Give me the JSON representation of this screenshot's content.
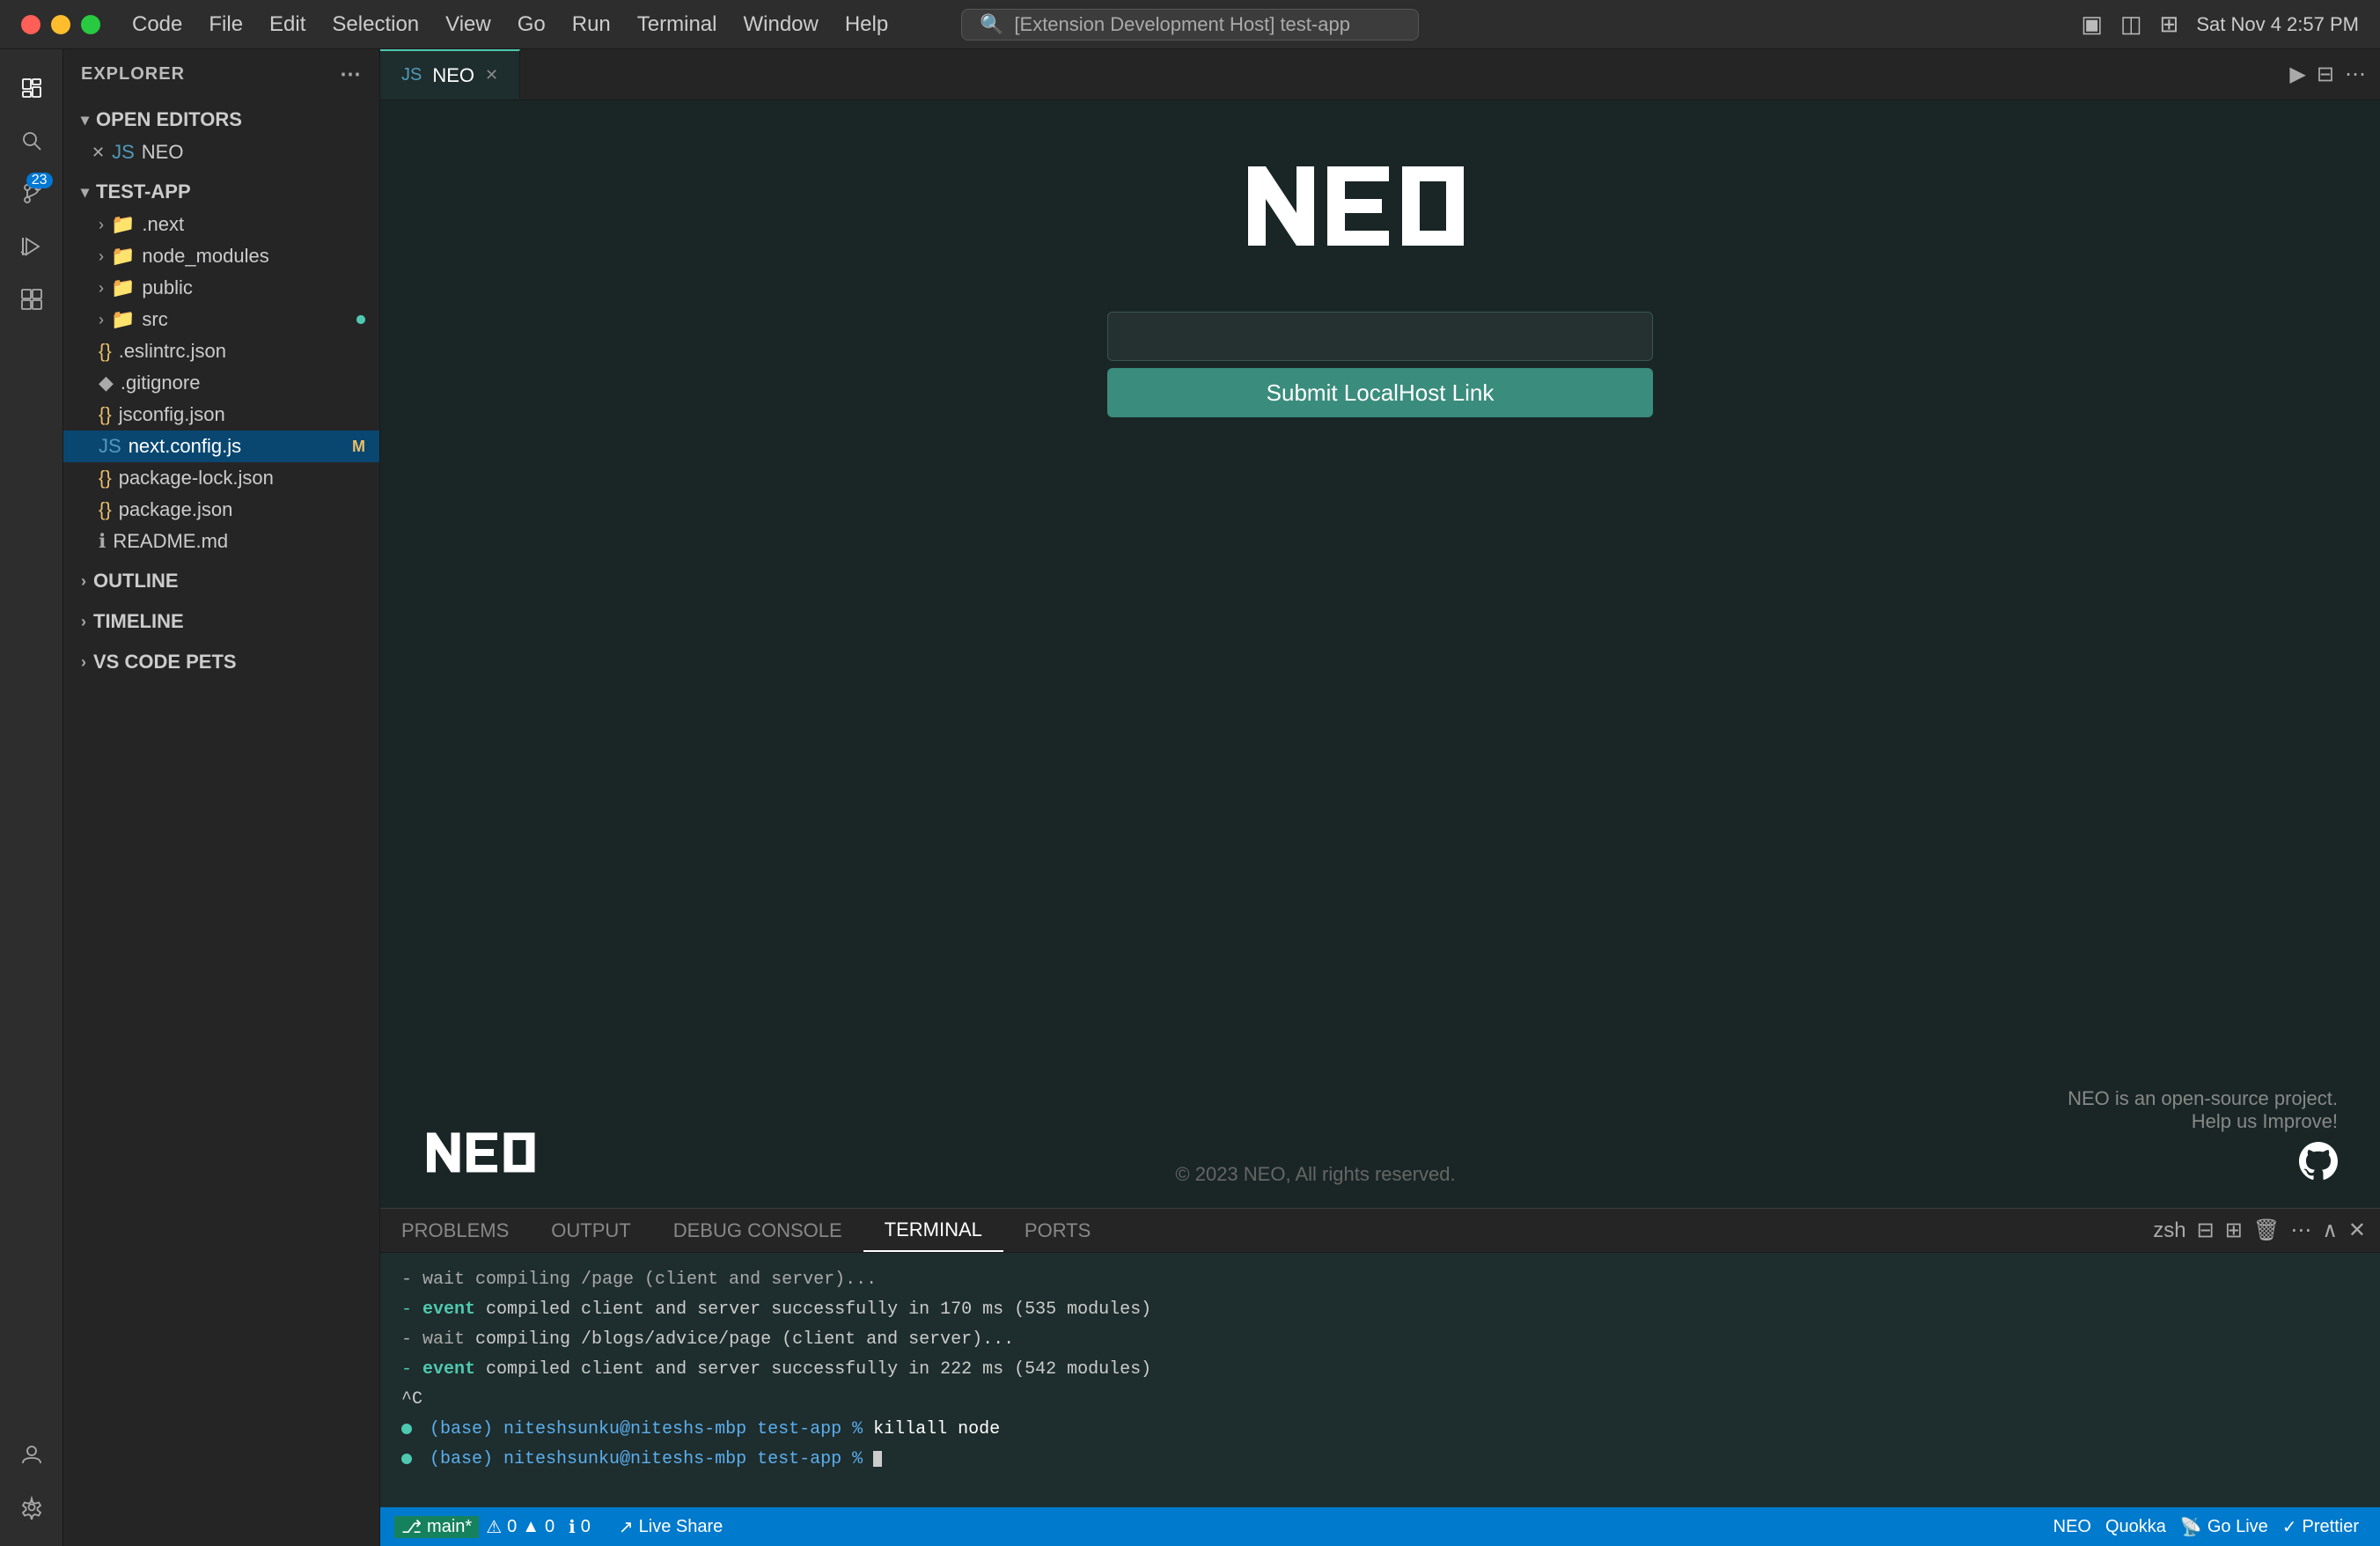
{
  "titlebar": {
    "menus": [
      "Code",
      "File",
      "Edit",
      "Selection",
      "View",
      "Go",
      "Run",
      "Terminal",
      "Window",
      "Help"
    ],
    "search_text": "[Extension Development Host] test-app",
    "time": "Sat Nov 4  2:57 PM"
  },
  "activity_bar": {
    "icons": [
      {
        "name": "files-icon",
        "symbol": "⬜",
        "label": "Explorer"
      },
      {
        "name": "search-icon",
        "symbol": "🔍",
        "label": "Search"
      },
      {
        "name": "source-control-icon",
        "symbol": "⎇",
        "label": "Source Control"
      },
      {
        "name": "run-icon",
        "symbol": "▶",
        "label": "Run"
      },
      {
        "name": "extensions-icon",
        "symbol": "⊞",
        "label": "Extensions"
      }
    ],
    "badge_count": "23"
  },
  "sidebar": {
    "title": "EXPLORER",
    "sections": {
      "open_editors": {
        "label": "OPEN EDITORS",
        "items": [
          {
            "name": "NEO",
            "icon": "js",
            "modified": false
          }
        ]
      },
      "test_app": {
        "label": "TEST-APP",
        "items": [
          {
            "name": ".next",
            "icon": "folder",
            "depth": 1
          },
          {
            "name": "node_modules",
            "icon": "folder",
            "depth": 1
          },
          {
            "name": "public",
            "icon": "folder",
            "depth": 1
          },
          {
            "name": "src",
            "icon": "folder",
            "depth": 1,
            "modified": true
          },
          {
            "name": ".eslintrc.json",
            "icon": "json",
            "depth": 1
          },
          {
            "name": ".gitignore",
            "icon": "git",
            "depth": 1
          },
          {
            "name": "jsconfig.json",
            "icon": "json",
            "depth": 1
          },
          {
            "name": "next.config.js",
            "icon": "js",
            "depth": 1,
            "badge": "M"
          },
          {
            "name": "package-lock.json",
            "icon": "json",
            "depth": 1
          },
          {
            "name": "package.json",
            "icon": "json",
            "depth": 1
          },
          {
            "name": "README.md",
            "icon": "md",
            "depth": 1
          }
        ]
      },
      "outline": {
        "label": "OUTLINE"
      },
      "timeline": {
        "label": "TIMELINE"
      },
      "vscode_pets": {
        "label": "VS CODE PETS"
      }
    }
  },
  "tab_bar": {
    "active_tab": "NEO",
    "tabs": [
      {
        "label": "NEO",
        "active": true
      }
    ]
  },
  "editor": {
    "neo_logo": "NEO",
    "input_placeholder": "",
    "submit_button": "Submit LocalHost Link",
    "footer": {
      "logo": "NEO",
      "copyright": "© 2023 NEO, All rights reserved.",
      "opensource_line1": "NEO is an open-source project.",
      "opensource_line2": "Help us Improve!"
    }
  },
  "panel": {
    "tabs": [
      {
        "label": "PROBLEMS",
        "active": false
      },
      {
        "label": "OUTPUT",
        "active": false
      },
      {
        "label": "DEBUG CONSOLE",
        "active": false
      },
      {
        "label": "TERMINAL",
        "active": true
      },
      {
        "label": "PORTS",
        "active": false
      }
    ],
    "terminal": {
      "shell": "zsh",
      "lines": [
        {
          "type": "wait",
          "text": "- wait  compiling /page (client and server)..."
        },
        {
          "type": "event",
          "text": "- event compiled client and server successfully in 170 ms (535 modules)"
        },
        {
          "type": "wait",
          "text": "- wait  compiling /blogs/advice/page (client and server)..."
        },
        {
          "type": "event",
          "text": "- event compiled client and server successfully in 222 ms (542 modules)"
        },
        {
          "type": "ctrl",
          "text": "^C"
        },
        {
          "type": "prompt",
          "text": "(base) niteshsunku@niteshs-mbp test-app % killall node"
        },
        {
          "type": "prompt_active",
          "text": "(base) niteshsunku@niteshs-mbp test-app %"
        }
      ]
    }
  },
  "status_bar": {
    "left": [
      {
        "label": "⎇ main*",
        "name": "git-branch"
      },
      {
        "label": "⚠ 0",
        "name": "errors"
      },
      {
        "label": "▲ 0",
        "name": "warnings"
      },
      {
        "label": "ℹ 0",
        "name": "info"
      }
    ],
    "live_share": "Live Share",
    "right": [
      {
        "label": "NEO",
        "name": "neo-status"
      },
      {
        "label": "Quokka",
        "name": "quokka-status"
      },
      {
        "label": "Go Live",
        "name": "go-live"
      },
      {
        "label": "Prettier",
        "name": "prettier-status"
      }
    ]
  }
}
